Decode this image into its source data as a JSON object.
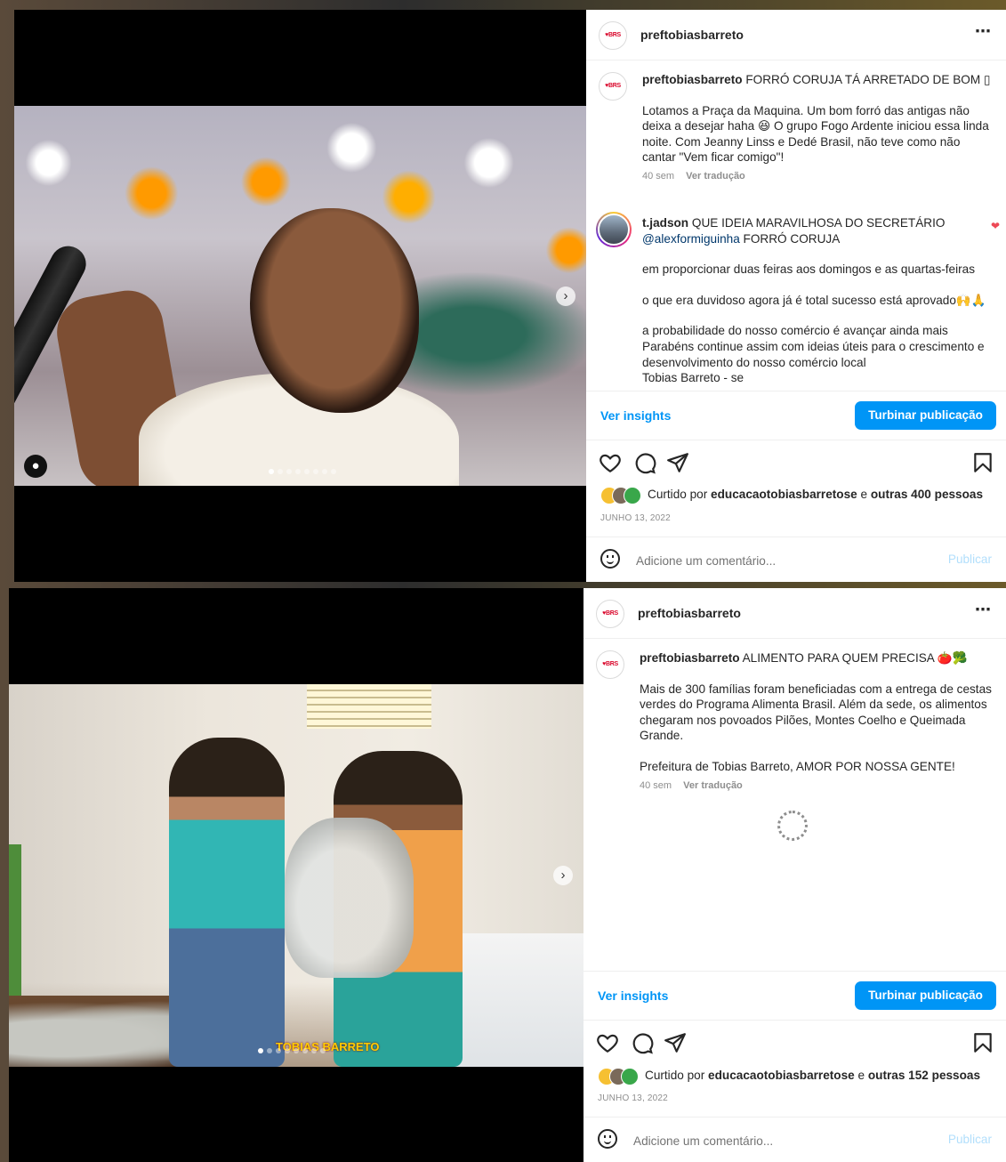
{
  "posts": [
    {
      "username": "preftobiasbarreto",
      "caption_title": "FORRÓ CORUJA TÁ ARRETADO DE BOM ▯",
      "caption_body": "Lotamos a Praça da Maquina. Um bom forró das antigas não deixa a desejar haha 😆 O grupo Fogo Ardente iniciou essa linda noite. Com Jeanny Linss e Dedé Brasil, não teve como não cantar \"Vem ficar comigo\"!",
      "caption_time": "40 sem",
      "translate_label": "Ver tradução",
      "comment": {
        "username": "t.jadson",
        "line1": "QUE IDEIA MARAVILHOSA DO SECRETÁRIO",
        "mention": "@alexformiguinha",
        "line2": "FORRÓ CORUJA",
        "para1": "em proporcionar duas feiras aos domingos e as quartas-feiras",
        "para2": "o que era duvidoso agora já é total sucesso está aprovado🙌🙏",
        "para3": "a probabilidade do nosso comércio é avançar ainda mais Parabéns continue assim com ideias úteis para o crescimento e desenvolvimento do nosso comércio local",
        "para4": "Tobias Barreto - se"
      },
      "insights_label": "Ver insights",
      "boost_label": "Turbinar publicação",
      "liked_prefix": "Curtido por",
      "liked_user": "educacaotobiasbarretose",
      "liked_and": "e",
      "liked_others": "outras 400 pessoas",
      "date": "JUNHO 13, 2022",
      "comment_placeholder": "Adicione um comentário...",
      "publish_label": "Publicar",
      "more_icon": "⋯"
    },
    {
      "username": "preftobiasbarreto",
      "caption_title": "ALIMENTO PARA QUEM PRECISA 🍅🥦",
      "caption_body": "Mais de 300 famílias foram beneficiadas com a entrega de cestas verdes do Programa Alimenta Brasil. Além da sede, os alimentos chegaram nos povoados Pilões, Montes Coelho e Queimada Grande.",
      "caption_body2": "Prefeitura de Tobias Barreto, AMOR POR NOSSA GENTE!",
      "caption_time": "40 sem",
      "translate_label": "Ver tradução",
      "insights_label": "Ver insights",
      "boost_label": "Turbinar publicação",
      "liked_prefix": "Curtido por",
      "liked_user": "educacaotobiasbarretose",
      "liked_and": "e",
      "liked_others": "outras 152 pessoas",
      "date": "JUNHO 13, 2022",
      "comment_placeholder": "Adicione um comentário...",
      "publish_label": "Publicar",
      "more_icon": "⋯",
      "watermark": "TOBIAS BARRETO"
    }
  ],
  "colors": {
    "accent": "#0095f6",
    "like_red": "#ed4956",
    "muted": "#8e8e8e",
    "text": "#262626"
  },
  "icons": [
    "heart-icon",
    "comment-bubble-icon",
    "share-paper-plane-icon",
    "bookmark-icon",
    "emoji-smile-icon",
    "chevron-right-icon",
    "more-dots-icon",
    "user-tag-icon",
    "loading-spinner-icon"
  ]
}
